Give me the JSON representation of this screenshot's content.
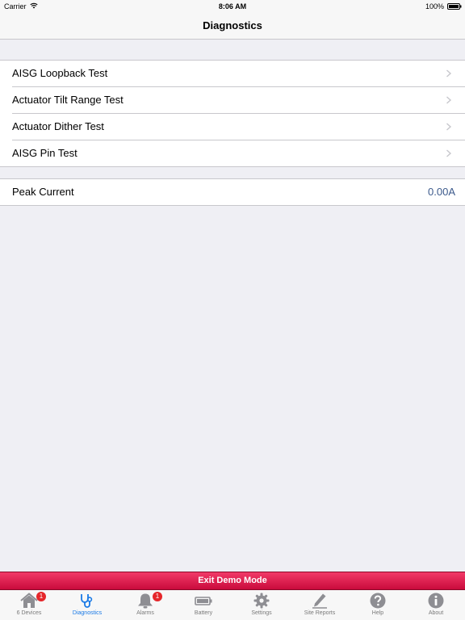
{
  "status_bar": {
    "carrier": "Carrier",
    "time": "8:06 AM",
    "battery": "100%"
  },
  "nav": {
    "title": "Diagnostics"
  },
  "tests": [
    {
      "label": "AISG Loopback Test"
    },
    {
      "label": "Actuator Tilt Range Test"
    },
    {
      "label": "Actuator Dither Test"
    },
    {
      "label": "AISG Pin Test"
    }
  ],
  "peak_current": {
    "label": "Peak Current",
    "value": "0.00A"
  },
  "demo": {
    "exit_label": "Exit Demo Mode"
  },
  "tabs": [
    {
      "label": "6 Devices",
      "icon": "home-icon",
      "badge": "1"
    },
    {
      "label": "Diagnostics",
      "icon": "stethoscope-icon",
      "active": true
    },
    {
      "label": "Alarms",
      "icon": "bell-icon",
      "badge": "1"
    },
    {
      "label": "Battery",
      "icon": "battery-icon"
    },
    {
      "label": "Settings",
      "icon": "gear-icon"
    },
    {
      "label": "Site Reports",
      "icon": "pencil-icon"
    },
    {
      "label": "Help",
      "icon": "help-icon"
    },
    {
      "label": "About",
      "icon": "info-icon"
    }
  ],
  "colors": {
    "accent": "#1a7ae6",
    "exit_bar": "#e01c4d",
    "badge": "#e5262a",
    "value_text": "#3c5a8c"
  }
}
